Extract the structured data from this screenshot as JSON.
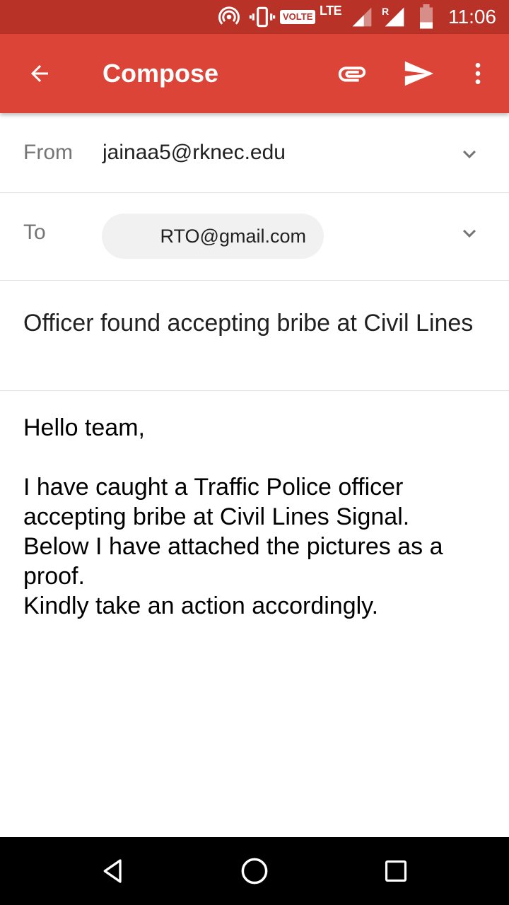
{
  "status_bar": {
    "volte_label": "VOLTE",
    "network_label": "LTE",
    "roaming_label": "R",
    "time": "11:06",
    "icons": [
      "hotspot-icon",
      "vibrate-icon",
      "signal-icon",
      "battery-icon"
    ]
  },
  "toolbar": {
    "title": "Compose",
    "icons": [
      "back-arrow-icon",
      "paperclip-icon",
      "send-icon",
      "more-vert-icon"
    ]
  },
  "compose": {
    "from_label": "From",
    "from_value": "jainaa5@rknec.edu",
    "to_label": "To",
    "to_chip": "RTO@gmail.com",
    "subject": "Officer found accepting bribe at Civil Lines",
    "body": {
      "greeting": "Hello team,",
      "line1": "I have caught a Traffic Police officer accepting bribe at Civil Lines Signal.",
      "line2": "Below I have attached the pictures as a proof.",
      "line3": "Kindly take an action accordingly."
    }
  },
  "nav_bar": {
    "icons": [
      "back-triangle-icon",
      "home-circle-icon",
      "recents-square-icon"
    ]
  },
  "colors": {
    "status_bar": "#b93227",
    "app_bar": "#db4437",
    "chip_background": "#f1f1f1",
    "divider": "#e0e0e0"
  }
}
